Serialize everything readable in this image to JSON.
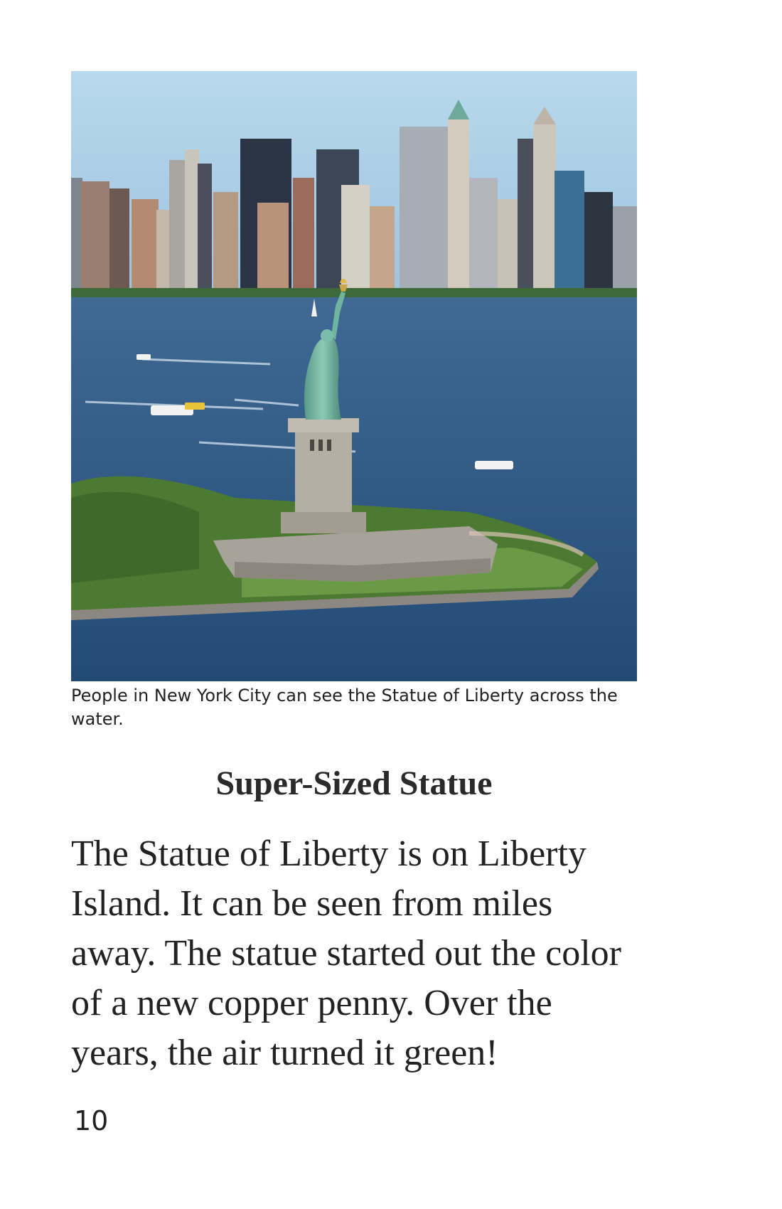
{
  "photo": {
    "subject": "statue-of-liberty-harbor-photo"
  },
  "caption": "People in New York City can see the Statue of Liberty across the water.",
  "heading": "Super-Sized Statue",
  "body": "The Statue of Liberty is on Liberty Island. It can be seen from miles away. The statue started out the color of a new copper penny. Over the years, the air turned it green!",
  "page_number": "10",
  "colors": {
    "sky": "#a9cfe6",
    "water": "#2f5a86",
    "statue_green": "#6fb3a0",
    "grass": "#5e8f3a",
    "stone": "#a8a39a"
  }
}
